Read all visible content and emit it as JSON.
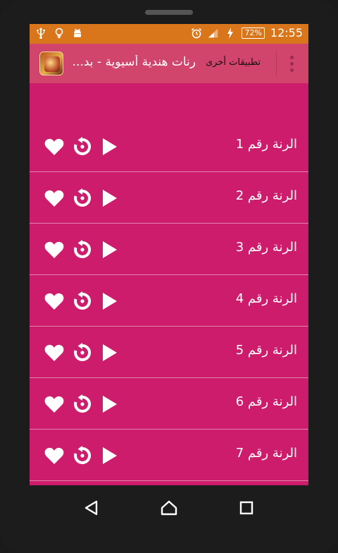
{
  "status_bar": {
    "left_icons": [
      "usb-icon",
      "lightbulb-icon",
      "android-icon"
    ],
    "right_icons": [
      "alarm-icon",
      "signal-icon",
      "charging-icon"
    ],
    "battery": "72%",
    "time": "12:55"
  },
  "app_bar": {
    "title": "رنات هندية أسيوية - بد...",
    "other_apps": "تطبيقات أخرى",
    "menu_icon": "more-vertical-icon"
  },
  "ringtones": [
    {
      "label": "الرنة رقم 1"
    },
    {
      "label": "الرنة رقم 2"
    },
    {
      "label": "الرنة رقم 3"
    },
    {
      "label": "الرنة رقم 4"
    },
    {
      "label": "الرنة رقم 5"
    },
    {
      "label": "الرنة رقم 6"
    },
    {
      "label": "الرنة رقم 7"
    }
  ],
  "row_icons": [
    "heart-icon",
    "replay-icon",
    "play-icon"
  ],
  "nav": [
    "back-icon",
    "home-icon",
    "recents-icon"
  ],
  "colors": {
    "status_bar": "#d9761b",
    "app_bar": "#d1446b",
    "list_bg": "#cd1c6c"
  }
}
